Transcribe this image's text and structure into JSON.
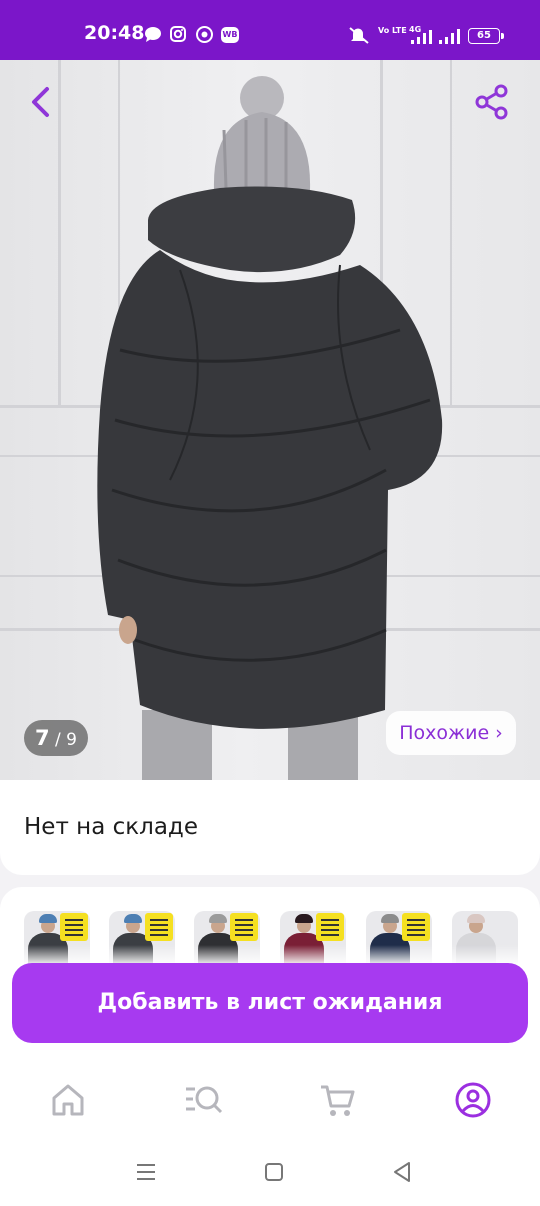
{
  "status_bar": {
    "time": "20:48",
    "wb_badge": "WB",
    "volte": "Vo LTE",
    "net": "4G",
    "battery": "65"
  },
  "gallery": {
    "current": "7",
    "separator": " / ",
    "total": "9",
    "similar_label": "Похожие ›"
  },
  "stock": {
    "text": "Нет на складе"
  },
  "thumbnails": [
    {
      "name": "thumb-1",
      "hat": "#4d7fb3",
      "coat": "#3b3e43"
    },
    {
      "name": "thumb-2",
      "hat": "#4d7fb3",
      "coat": "#3b3e43"
    },
    {
      "name": "thumb-3",
      "hat": "#9b9b9b",
      "coat": "#2e2f33"
    },
    {
      "name": "thumb-4",
      "hat": "#5a1f2f",
      "coat": "#7a1f36"
    },
    {
      "name": "thumb-5",
      "hat": "#8c8c8c",
      "coat": "#1f2d4a"
    },
    {
      "name": "thumb-6",
      "hat": "#d9c7c2",
      "coat": "#d6d6d9"
    }
  ],
  "action": {
    "add_waitlist_label": "Добавить в лист ожидания"
  },
  "bottom_nav": [
    "home-icon",
    "catalog-search-icon",
    "cart-icon",
    "profile-icon"
  ],
  "colors": {
    "brand": "#7b16c9",
    "button": "#a73af0",
    "accent_text": "#8b2fd6",
    "nav_active": "#9b2fe0",
    "nav_inactive": "#b6b6bc"
  }
}
